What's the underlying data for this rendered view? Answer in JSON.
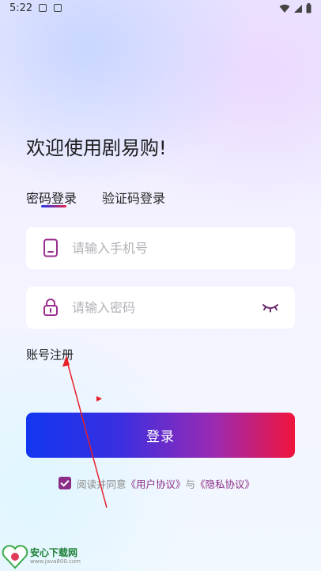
{
  "status_bar": {
    "time": "5:22"
  },
  "header": {
    "welcome": "欢迎使用剧易购!"
  },
  "tabs": [
    {
      "label": "密码登录",
      "active": true
    },
    {
      "label": "验证码登录",
      "active": false
    }
  ],
  "form": {
    "phone_placeholder": "请输入手机号",
    "password_placeholder": "请输入密码"
  },
  "register_link": "账号注册",
  "login_button": "登录",
  "agreement": {
    "prefix": "阅读并同意",
    "user_agreement": "《用户协议》",
    "and": "与",
    "privacy": "《隐私协议》",
    "checked": true
  },
  "watermark": {
    "title": "安心下载网",
    "url": "www.java800.com"
  },
  "colors": {
    "accent": "#8b2d86",
    "gradient_start": "#1236f0",
    "gradient_end": "#f0143c",
    "annotation": "#e8202a"
  }
}
